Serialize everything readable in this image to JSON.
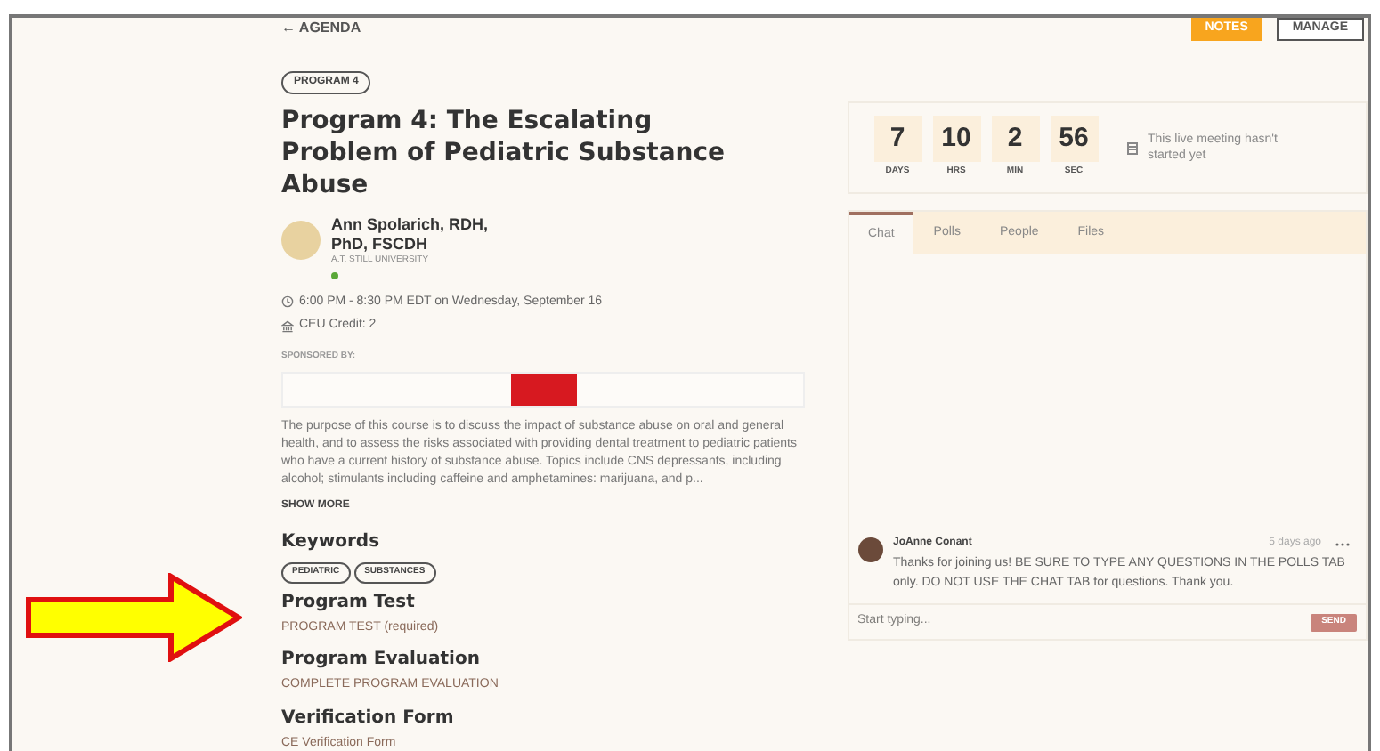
{
  "header": {
    "back_link": "← AGENDA",
    "buttons": [
      "NOTES",
      "MANAGE"
    ]
  },
  "program": {
    "badge": "PROGRAM 4",
    "title": "Program 4: The Escalating Problem of Pediatric Substance Abuse",
    "speaker": {
      "name": "Ann Spolarich, RDH, PhD, FSCDH",
      "affiliation": "A.T. STILL UNIVERSITY",
      "online": true
    },
    "time": "6:00 PM - 8:30 PM EDT on Wednesday, September 16",
    "credit": "CEU Credit: 2",
    "sponsored_label": "SPONSORED BY:",
    "description": "The purpose of this course is to discuss the impact of substance abuse on oral and general health, and to assess the risks associated with providing dental treatment to pediatric patients who have a current history of substance abuse. Topics include CNS depressants, including alcohol; stimulants including caffeine and amphetamines: marijuana, and p...",
    "show_more": "SHOW MORE"
  },
  "keywords": {
    "heading": "Keywords",
    "tags": [
      "PEDIATRIC",
      "SUBSTANCES"
    ]
  },
  "sections": [
    {
      "heading": "Program Test",
      "link": "PROGRAM TEST (required)"
    },
    {
      "heading": "Program Evaluation",
      "link": "COMPLETE PROGRAM EVALUATION"
    },
    {
      "heading": "Verification Form",
      "link": "CE Verification Form"
    }
  ],
  "countdown": {
    "units": [
      {
        "value": "7",
        "label": "DAYS"
      },
      {
        "value": "10",
        "label": "HRS"
      },
      {
        "value": "2",
        "label": "MIN"
      },
      {
        "value": "56",
        "label": "SEC"
      }
    ],
    "status": "This live meeting hasn't started yet"
  },
  "chat": {
    "tabs": [
      {
        "label": "Chat",
        "selected": true
      },
      {
        "label": "Polls",
        "selected": false
      },
      {
        "label": "People",
        "selected": false
      },
      {
        "label": "Files",
        "selected": false
      }
    ],
    "messages": [
      {
        "author": "JoAnne Conant",
        "time": "5 days ago",
        "text": "Thanks for joining us! BE SURE TO TYPE ANY QUESTIONS IN THE POLLS TAB only. DO NOT USE THE CHAT TAB for questions. Thank you."
      }
    ],
    "input": {
      "placeholder": "Start typing..."
    },
    "send": "SEND"
  }
}
